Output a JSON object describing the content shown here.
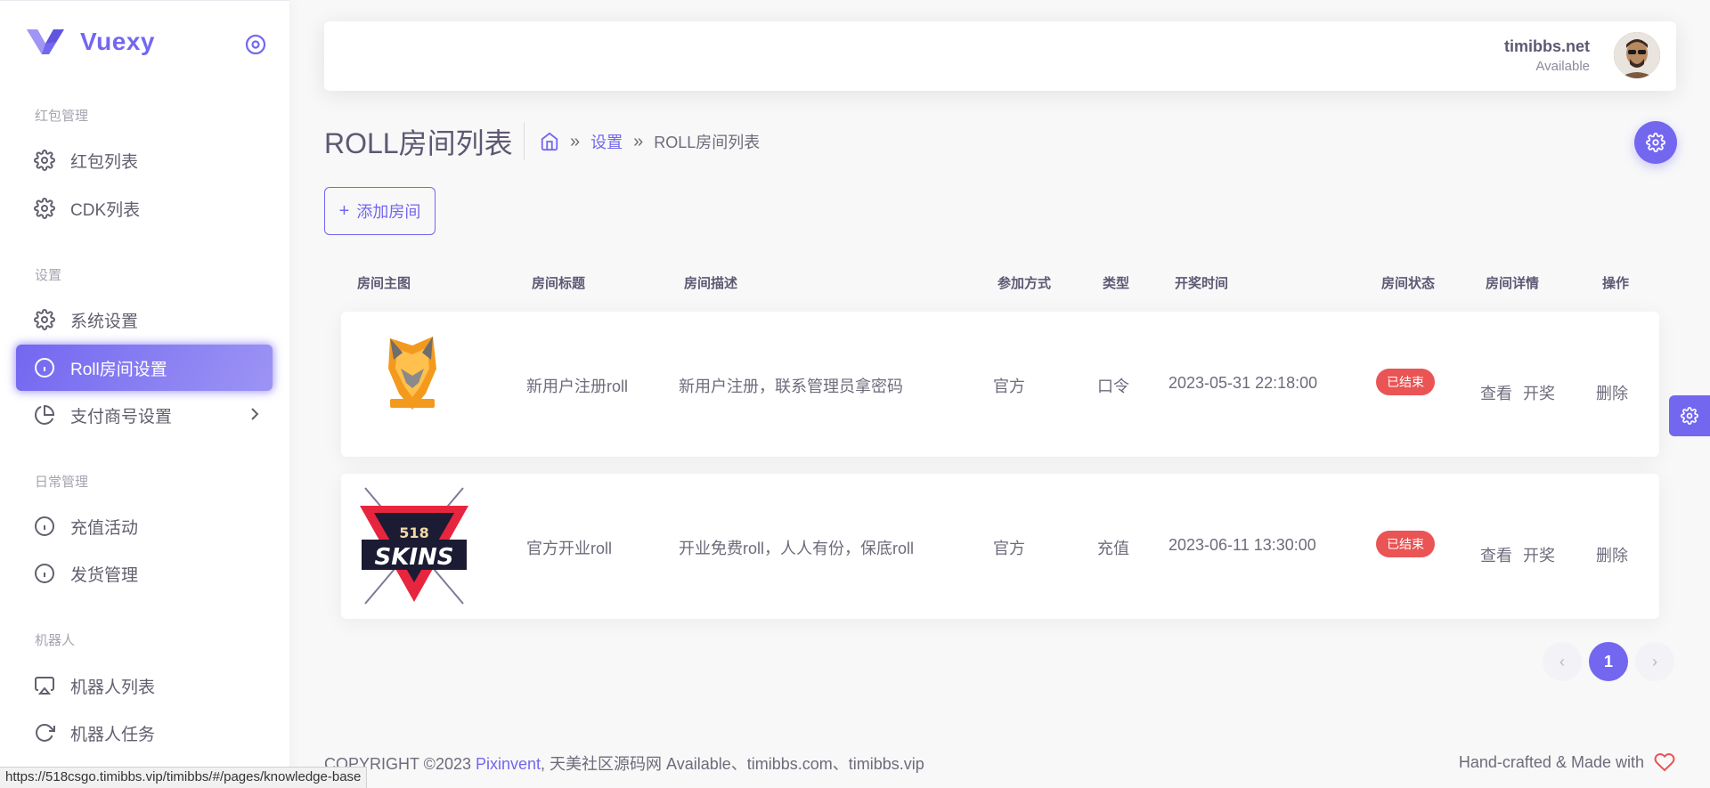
{
  "brand": {
    "name": "Vuexy"
  },
  "sidebar": {
    "sections": [
      {
        "header": "红包管理",
        "items": [
          {
            "label": "红包列表",
            "icon": "gear-icon"
          },
          {
            "label": "CDK列表",
            "icon": "gear-icon"
          }
        ]
      },
      {
        "header": "设置",
        "items": [
          {
            "label": "系统设置",
            "icon": "gear-icon"
          },
          {
            "label": "Roll房间设置",
            "icon": "info-icon",
            "active": true
          },
          {
            "label": "支付商号设置",
            "icon": "pie-chart-icon"
          }
        ]
      },
      {
        "header": "日常管理",
        "items": [
          {
            "label": "充值活动",
            "icon": "info-icon"
          },
          {
            "label": "发货管理",
            "icon": "info-icon"
          }
        ]
      },
      {
        "header": "机器人",
        "items": [
          {
            "label": "机器人列表",
            "icon": "airplay-icon"
          },
          {
            "label": "机器人任务",
            "icon": "refresh-icon"
          }
        ]
      }
    ]
  },
  "navbar": {
    "user_name": "timibbs.net",
    "user_status": "Available"
  },
  "page": {
    "title": "ROLL房间列表",
    "breadcrumb": {
      "parent": "设置",
      "current": "ROLL房间列表"
    },
    "add_button": "添加房间"
  },
  "table": {
    "headers": [
      "房间主图",
      "房间标题",
      "房间描述",
      "参加方式",
      "类型",
      "开奖时间",
      "房间状态",
      "房间详情",
      "操作"
    ],
    "rows": [
      {
        "title": "新用户注册roll",
        "desc": "新用户注册，联系管理员拿密码",
        "join": "官方",
        "type": "口令",
        "time": "2023-05-31 22:18:00",
        "status": "已结束",
        "view": "查看",
        "draw": "开奖",
        "delete": "删除"
      },
      {
        "title": "官方开业roll",
        "desc": "开业免费roll，人人有份，保底roll",
        "join": "官方",
        "type": "充值",
        "time": "2023-06-11 13:30:00",
        "status": "已结束",
        "view": "查看",
        "draw": "开奖",
        "delete": "删除",
        "logo_top": "518",
        "logo_bottom": "SKINS"
      }
    ]
  },
  "pagination": {
    "prev": "‹",
    "current": "1",
    "next": "›"
  },
  "footer": {
    "copyright": "COPYRIGHT ©2023 ",
    "brand_link": "Pixinvent",
    "rest": ", 天美社区源码网 Available、timibbs.com、timibbs.vip",
    "right": "Hand-crafted & Made with"
  },
  "status_bar_url": "https://518csgo.timibbs.vip/timibbs/#/pages/knowledge-base",
  "colors": {
    "primary": "#7367f0",
    "danger": "#ea5455"
  }
}
